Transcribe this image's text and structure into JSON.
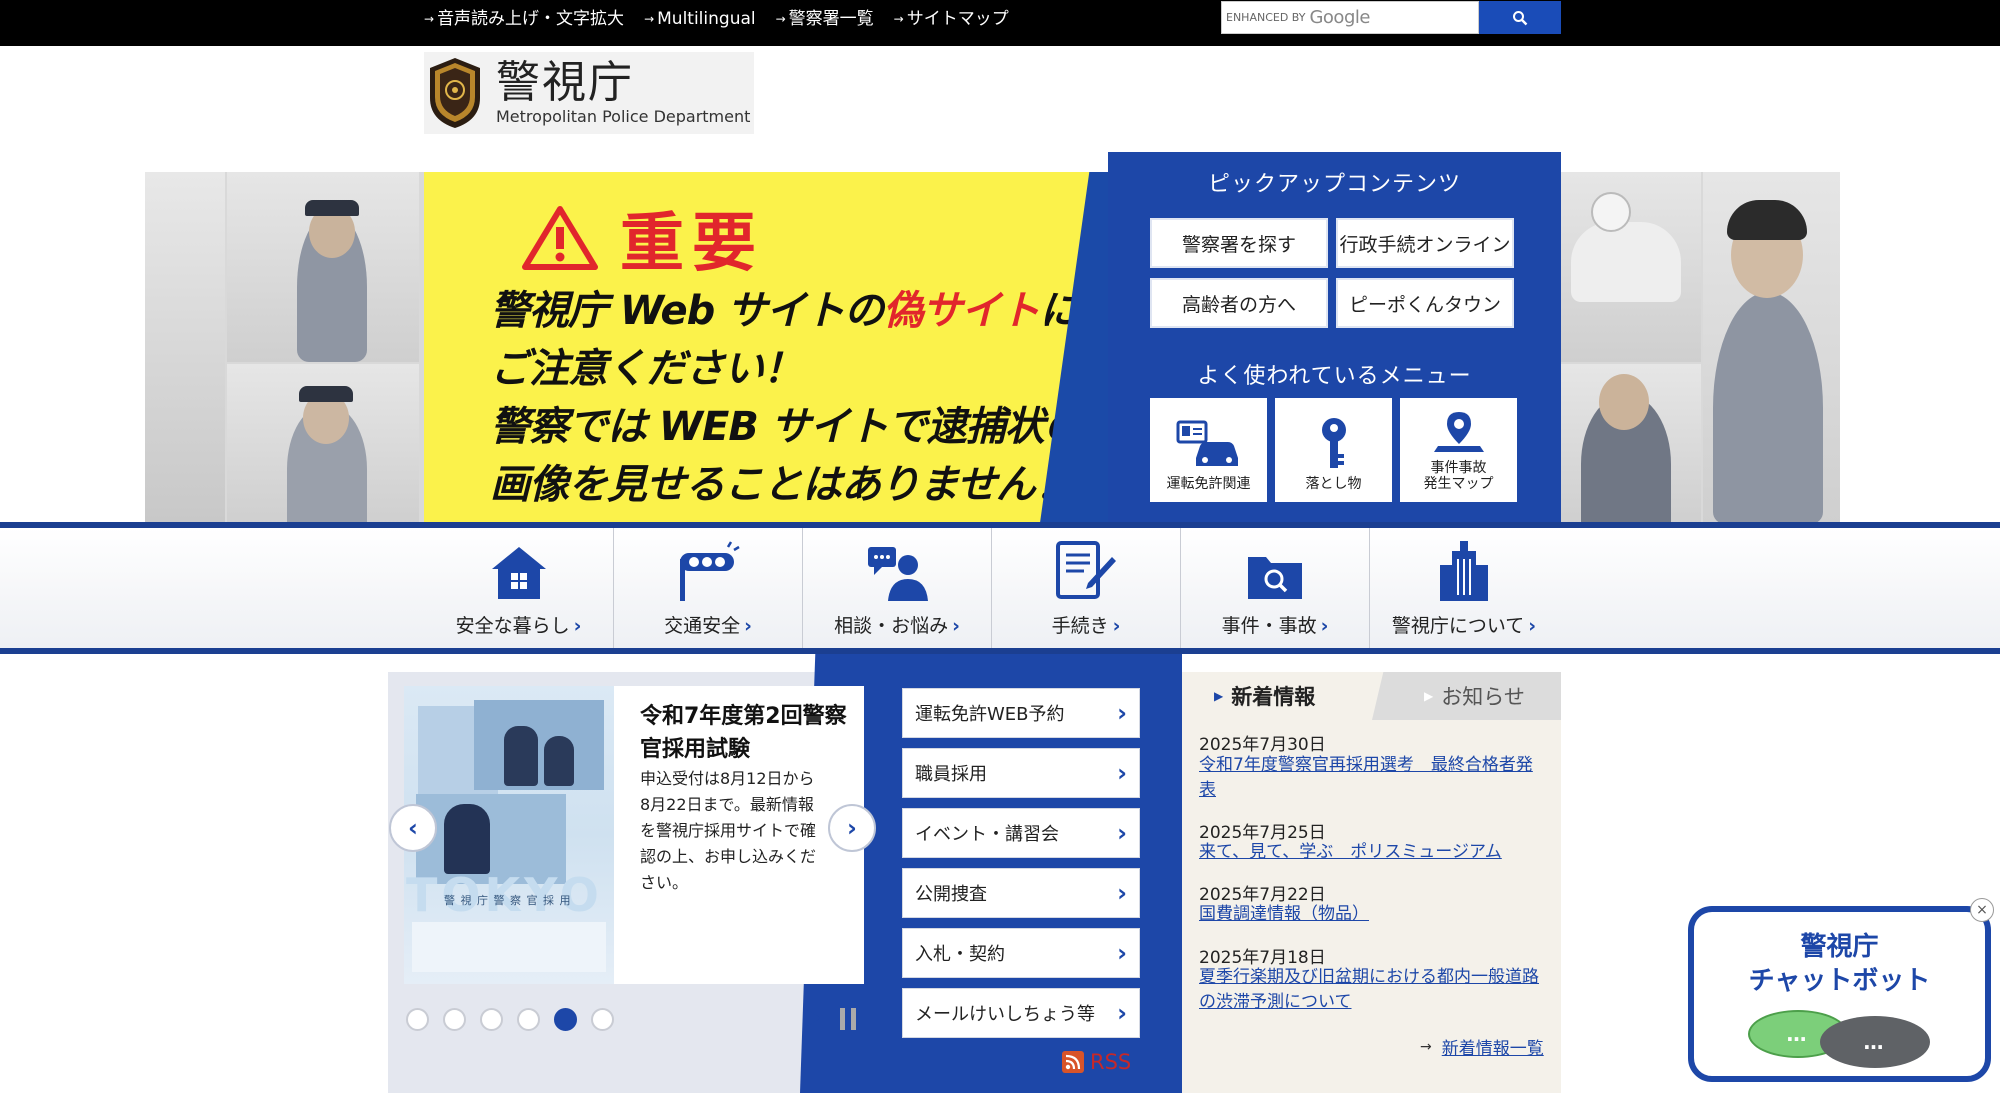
{
  "topbar": {
    "links": [
      "音声読み上げ・文字拡大",
      "Multilingual",
      "警察署一覧",
      "サイトマップ"
    ],
    "search_label": "ENHANCED BY",
    "search_brand": "Google"
  },
  "header": {
    "title": "警視庁",
    "subtitle": "Metropolitan Police Department"
  },
  "banner": {
    "heading": "重要",
    "line1_a": "警視庁 Web サイトの",
    "line1_b": "偽サイト",
    "line1_c": "に",
    "line2": "ご注意ください！",
    "line3": "警察では WEB サイトで逮捕状の",
    "line4": "画像を見せることはありません！"
  },
  "pickup": {
    "title": "ピックアップコンテンツ",
    "buttons": [
      "警察署を探す",
      "行政手続オンライン",
      "高齢者の方へ",
      "ピーポくんタウン"
    ],
    "menu_title": "よく使われているメニュー",
    "menu": [
      "運転免許関連",
      "落とし物",
      "事件事故\n発生マップ"
    ]
  },
  "nav": {
    "items": [
      "安全な暮らし",
      "交通安全",
      "相談・お悩み",
      "手続き",
      "事件・事故",
      "警視庁について"
    ]
  },
  "slider": {
    "title": "令和7年度第2回警察官採用試験",
    "text": "申込受付は8月12日から8月22日まで。最新情報を警視庁採用サイトで確認の上、お申し込みください。",
    "poster_text": "TOKYO",
    "poster_caption": "警 視 庁 警 察 官 採 用",
    "active_dot": 5,
    "dot_count": 6
  },
  "quick_links": [
    "運転免許WEB予約",
    "職員採用",
    "イベント・講習会",
    "公開捜査",
    "入札・契約",
    "メールけいしちょう等"
  ],
  "rss": "RSS",
  "news": {
    "tab_active": "新着情報",
    "tab_other": "お知らせ",
    "items": [
      {
        "date": "2025年7月30日",
        "title": "令和7年度警察官再採用選考　最終合格者発表"
      },
      {
        "date": "2025年7月25日",
        "title": "来て、見て、学ぶ　ポリスミュージアム"
      },
      {
        "date": "2025年7月22日",
        "title": "国費調達情報（物品）"
      },
      {
        "date": "2025年7月18日",
        "title": "夏季行楽期及び旧盆期における都内一般道路の渋滞予測について"
      }
    ],
    "more": "新着情報一覧"
  },
  "chatbot": {
    "title_line1": "警視庁",
    "title_line2": "チャットボット",
    "bubble_text": "…"
  },
  "colors": {
    "brand_blue": "#1d47a8",
    "banner_yellow": "#fbf24b",
    "alert_red": "#e1262c"
  }
}
